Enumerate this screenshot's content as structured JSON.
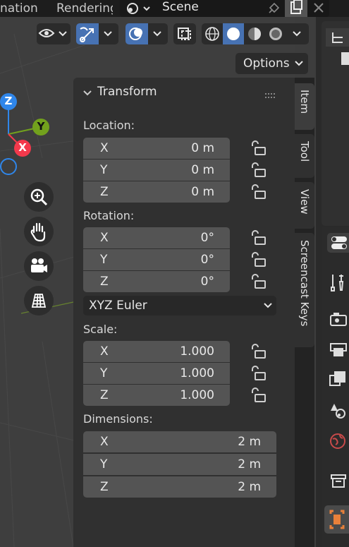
{
  "tabs": {
    "animation": "nation",
    "rendering": "Rendering"
  },
  "scene": {
    "name": "Scene"
  },
  "viewport": {
    "options_label": "Options",
    "gizmo": {
      "z": "Z",
      "y": "Y",
      "x": "X"
    }
  },
  "panel": {
    "title": "Transform",
    "location": {
      "label": "Location:",
      "rows": [
        {
          "axis": "X",
          "value": "0 m"
        },
        {
          "axis": "Y",
          "value": "0 m"
        },
        {
          "axis": "Z",
          "value": "0 m"
        }
      ]
    },
    "rotation": {
      "label": "Rotation:",
      "rows": [
        {
          "axis": "X",
          "value": "0°"
        },
        {
          "axis": "Y",
          "value": "0°"
        },
        {
          "axis": "Z",
          "value": "0°"
        }
      ],
      "mode": "XYZ Euler"
    },
    "scale": {
      "label": "Scale:",
      "rows": [
        {
          "axis": "X",
          "value": "1.000"
        },
        {
          "axis": "Y",
          "value": "1.000"
        },
        {
          "axis": "Z",
          "value": "1.000"
        }
      ]
    },
    "dimensions": {
      "label": "Dimensions:",
      "rows": [
        {
          "axis": "X",
          "value": "2 m"
        },
        {
          "axis": "Y",
          "value": "2 m"
        },
        {
          "axis": "Z",
          "value": "2 m"
        }
      ]
    }
  },
  "side_tabs": [
    "Item",
    "Tool",
    "View",
    "Screencast Keys"
  ],
  "colors": {
    "accent": "#4772b3",
    "axis_x": "#f3394c",
    "axis_y": "#72a11d",
    "axis_z": "#2f86ea",
    "active_tab_icon": "#e8803a"
  }
}
